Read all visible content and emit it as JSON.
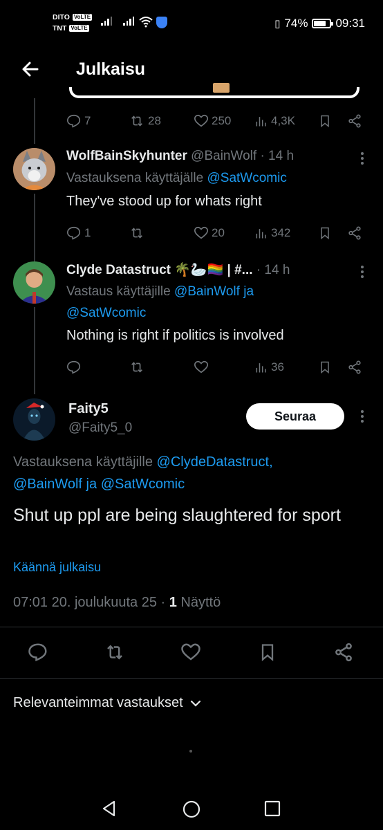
{
  "status_bar": {
    "carrier1": "DITO",
    "carrier2": "TNT",
    "volte": "VoLTE",
    "battery": "74%",
    "battery_level": 0.74,
    "time": "09:31"
  },
  "header": {
    "title": "Julkaisu"
  },
  "parent_actions": {
    "replies": "7",
    "reposts": "28",
    "likes": "250",
    "views": "4,3K"
  },
  "replies": [
    {
      "name": "WolfBainSkyhunter",
      "handle": "@BainWolf",
      "time": "· 14 h",
      "reply_prefix": "Vastauksena käyttäjälle",
      "reply_to": "@SatWcomic",
      "text": "They've stood up for whats right",
      "stats": {
        "replies": "1",
        "reposts": "",
        "likes": "20",
        "views": "342"
      }
    },
    {
      "name": "Clyde Datastruct 🌴🦢🏳️‍🌈 | #...",
      "handle": "",
      "time": "· 14 h",
      "reply_prefix": "Vastaus käyttäjille",
      "reply_to": "@BainWolf",
      "reply_joiner": "ja",
      "reply_to2": "@SatWcomic",
      "text": "Nothing is right if politics is involved",
      "stats": {
        "replies": "",
        "reposts": "",
        "likes": "",
        "views": "36"
      }
    }
  ],
  "main_post": {
    "name": "Faity5",
    "handle": "@Faity5_0",
    "follow_label": "Seuraa",
    "reply_prefix": "Vastauksena käyttäjille",
    "mention1": "@ClydeDatastruct,",
    "mention2": "@BainWolf",
    "joiner": "ja",
    "mention3": "@SatWcomic",
    "text": "Shut up ppl are being slaughtered for sport",
    "translate": "Käännä julkaisu",
    "timestamp": "07:01 20. joulukuuta 25 ·",
    "views_count": "1",
    "views_label": "Näyttö"
  },
  "sort": {
    "label": "Relevanteimmat vastaukset"
  },
  "colors": {
    "background": "#000000",
    "accent": "#1d9bf0",
    "muted": "#71767b",
    "text": "#e7e9ea"
  }
}
